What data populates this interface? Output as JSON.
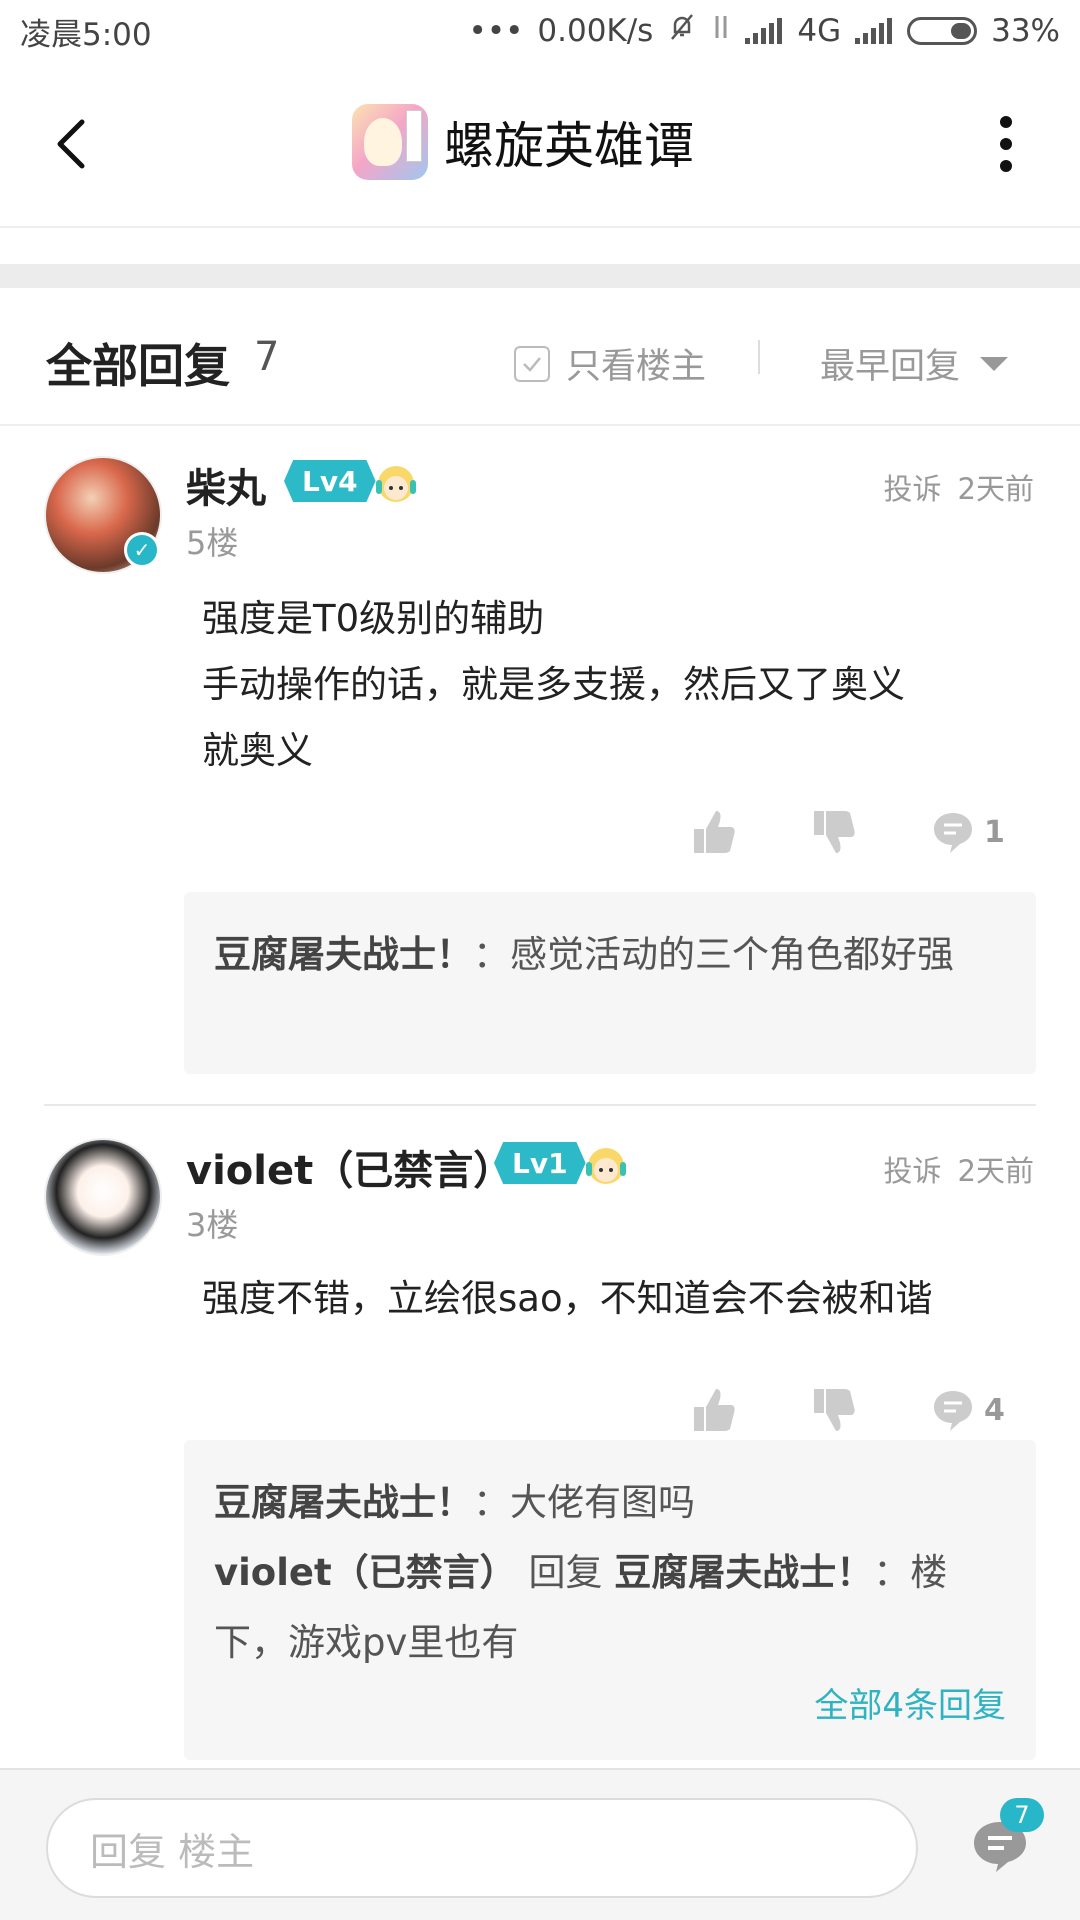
{
  "status_bar": {
    "time": "凌晨5:00",
    "dots": "•••",
    "speed": "0.00K/s",
    "network": "4G",
    "battery": "33%"
  },
  "nav": {
    "title": "螺旋英雄谭",
    "back_icon": "chevron-left-icon",
    "more_icon": "more-vertical-icon"
  },
  "filter": {
    "all_replies_label": "全部回复",
    "all_replies_count": "7",
    "only_op_label": "只看楼主",
    "sort_label": "最早回复"
  },
  "posts": [
    {
      "username": "柴丸",
      "level": "Lv4",
      "report": "投诉",
      "time": "2天前",
      "floor": "5楼",
      "content_lines": [
        "强度是T0级别的辅助",
        "手动操作的话，就是多支援，然后又了奥义",
        "就奥义"
      ],
      "comment_count": "1",
      "subreplies": [
        {
          "author": "豆腐屠夫战士！",
          "text": "：感觉活动的三个角色都好强"
        }
      ]
    },
    {
      "username": "violet（已禁言）",
      "level": "Lv1",
      "report": "投诉",
      "time": "2天前",
      "floor": "3楼",
      "content_lines": [
        "强度不错，立绘很sao，不知道会不会被和谐"
      ],
      "comment_count": "4",
      "subreplies": [
        {
          "author": "豆腐屠夫战士！",
          "text": "：大佬有图吗"
        },
        {
          "author": "violet（已禁言）",
          "mid": "回复",
          "target": "豆腐屠夫战士！",
          "text": "：楼下，游戏pv里也有"
        }
      ],
      "more_replies_label": "全部4条回复"
    }
  ],
  "bottom": {
    "input_placeholder": "回复  楼主",
    "badge_count": "7"
  },
  "colors": {
    "accent": "#2cb9c8",
    "muted": "#999999"
  }
}
